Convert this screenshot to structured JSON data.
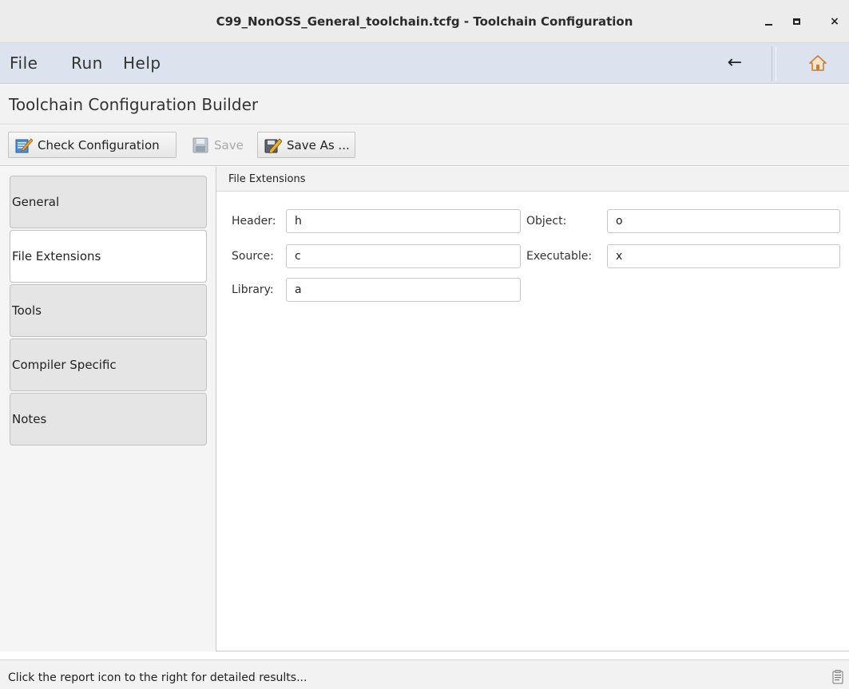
{
  "window": {
    "title": "C99_NonOSS_General_toolchain.tcfg - Toolchain Configuration",
    "minimize_icon": "minimize-icon",
    "maximize_icon": "maximize-icon",
    "close_glyph": "×"
  },
  "menubar": {
    "items": [
      {
        "label": "File"
      },
      {
        "label": "Run"
      },
      {
        "label": "Help"
      }
    ],
    "back_glyph": "←",
    "home_icon": "home-icon"
  },
  "heading": "Toolchain Configuration Builder",
  "toolbar": {
    "check_label": "Check Configuration",
    "save_label": "Save",
    "save_enabled": false,
    "save_as_label": "Save As ..."
  },
  "nav": {
    "items": [
      {
        "label": "General",
        "active": false
      },
      {
        "label": "File Extensions",
        "active": true
      },
      {
        "label": "Tools",
        "active": false
      },
      {
        "label": "Compiler Specific",
        "active": false
      },
      {
        "label": "Notes",
        "active": false
      }
    ]
  },
  "section": {
    "title": "File Extensions",
    "fields": {
      "header": {
        "label": "Header:",
        "value": "h"
      },
      "source": {
        "label": "Source:",
        "value": "c"
      },
      "library": {
        "label": "Library:",
        "value": "a"
      },
      "object": {
        "label": "Object:",
        "value": "o"
      },
      "executable": {
        "label": "Executable:",
        "value": "x"
      }
    }
  },
  "status": {
    "message": "Click the report icon to the right for detailed results...",
    "report_icon": "report-icon"
  },
  "colors": {
    "menubar_bg": "#dde3ee",
    "title_bg": "#ececec",
    "panel_bg": "#f2f2f2",
    "disabled_text": "#a8a8a8"
  }
}
